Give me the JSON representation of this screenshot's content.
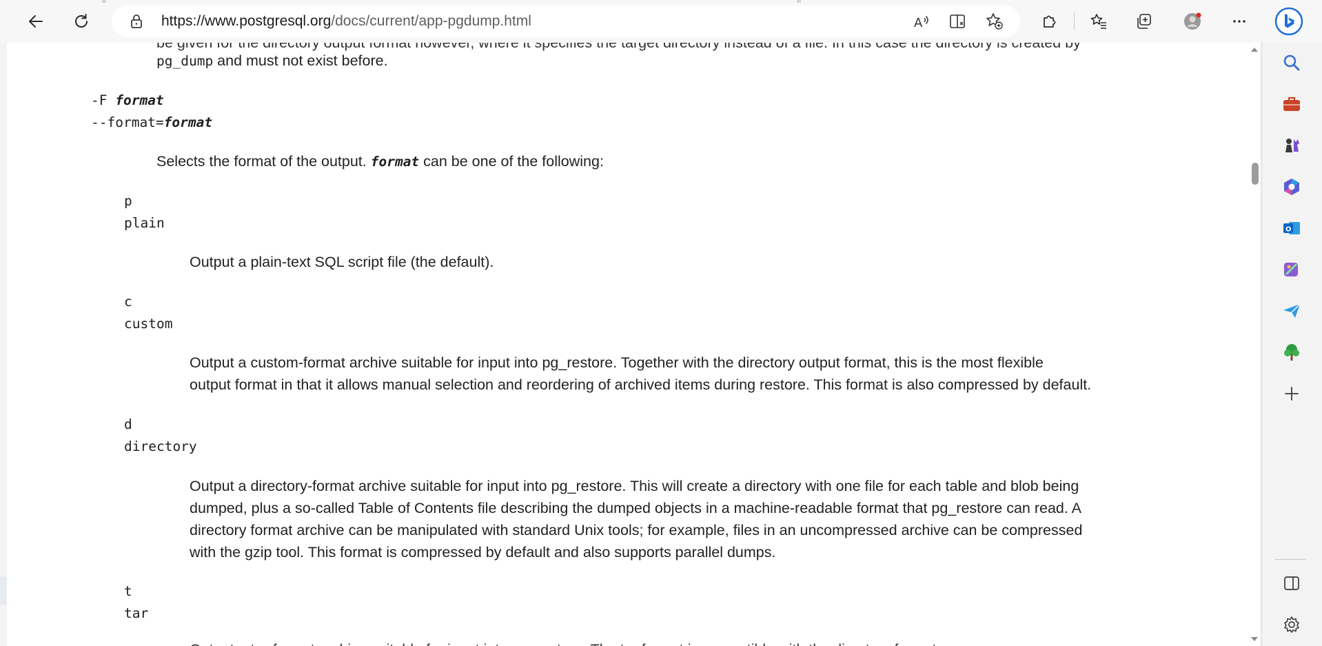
{
  "browser": {
    "url_host": "https://www.postgresql.org",
    "url_path": "/docs/current/app-pgdump.html"
  },
  "doc": {
    "top_clipped_line": "be given for the directory output format however, where it specifies the target directory instead of a file. In this case the directory is created by",
    "top_code": "pg_dump",
    "top_rest": " and must not exist before.",
    "flag_short_prefix": "-F ",
    "flag_short_arg": "format",
    "flag_long_prefix": "--format=",
    "flag_long_arg": "format",
    "intro_before": "Selects the format of the output. ",
    "intro_arg": "format",
    "intro_after": " can be one of the following:",
    "formats": [
      {
        "short": "p",
        "long": "plain",
        "lines": [
          "Output a plain-text SQL script file (the default)."
        ]
      },
      {
        "short": "c",
        "long": "custom",
        "lines": [
          "Output a custom-format archive suitable for input into pg_restore. Together with the directory output format, this is the most flexible",
          "output format in that it allows manual selection and reordering of archived items during restore. This format is also compressed by default."
        ]
      },
      {
        "short": "d",
        "long": "directory",
        "lines": [
          "Output a directory-format archive suitable for input into pg_restore. This will create a directory with one file for each table and blob being",
          "dumped, plus a so-called Table of Contents file describing the dumped objects in a machine-readable format that pg_restore can read. A",
          "directory format archive can be manipulated with standard Unix tools; for example, files in an uncompressed archive can be compressed",
          "with the gzip tool. This format is compressed by default and also supports parallel dumps."
        ]
      },
      {
        "short": "t",
        "long": "tar",
        "lines": []
      }
    ],
    "bottom_clipped_line": "Output a tar-format archive suitable for input into pg_restore. The tar format is compatible with the directory format"
  },
  "colors": {
    "accent_bing": "#1f6fd8",
    "briefcase": "#c8432b",
    "outlook": "#0a64c8",
    "tree": "#2e9a3e"
  }
}
